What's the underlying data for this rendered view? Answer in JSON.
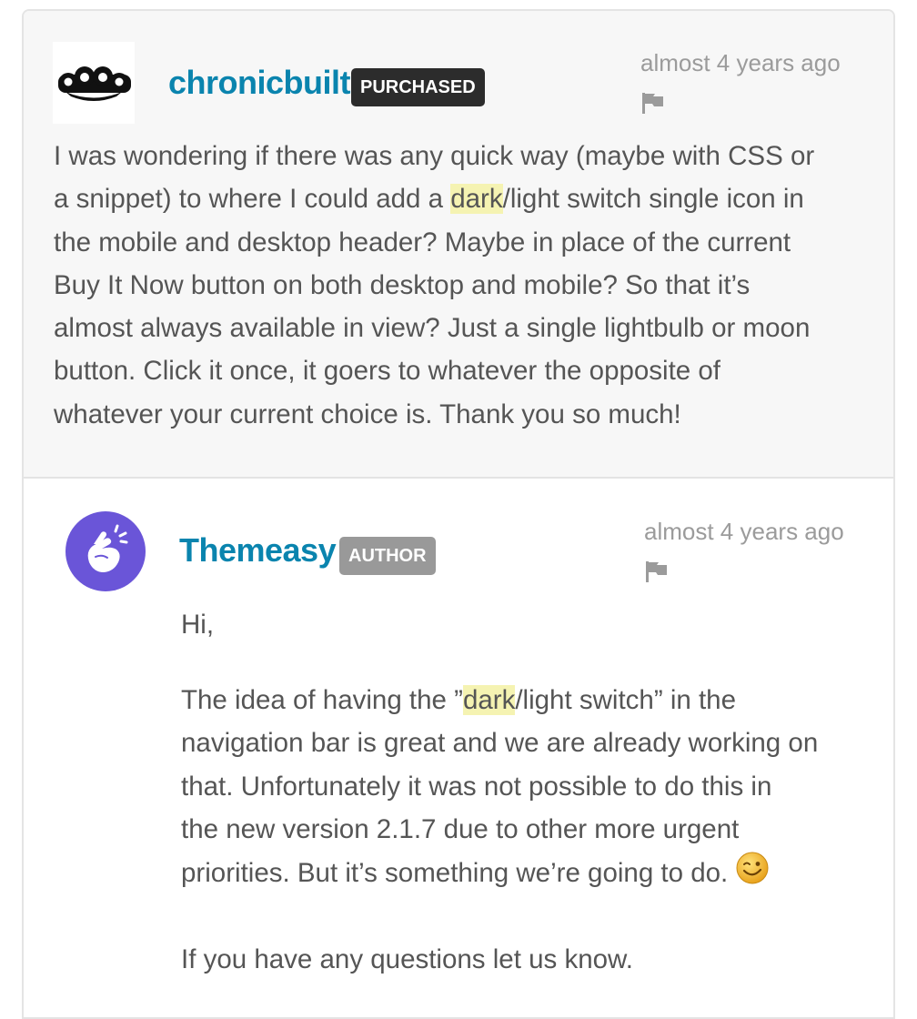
{
  "comments": [
    {
      "username": "chronicbuilt",
      "badge": "PURCHASED",
      "timestamp": "almost 4 years ago",
      "avatar_icon": "brass-knuckles-icon",
      "body_lines": [
        "I was wondering if there was any quick way (maybe with CSS or",
        "a snippet) to where I could add a ",
        "dark",
        "/light switch single icon in",
        "the mobile and desktop header? Maybe in place of the current",
        "Buy It Now button on both desktop and mobile? So that it’s",
        "almost always available in view? Just a single lightbulb or moon",
        "button. Click it once, it goers to whatever the opposite of",
        "whatever your current choice is. Thank you so much!"
      ]
    },
    {
      "username": "Themeasy",
      "badge": "AUTHOR",
      "timestamp": "almost 4 years ago",
      "avatar_icon": "snapping-hand-icon",
      "avatar_color": "#6a55d8",
      "greeting": "Hi,",
      "para2_lines": [
        "The idea of having the ”",
        "dark",
        "/light switch” in the",
        "navigation bar is great and we are already working on",
        "that. Unfortunately it was not possible to do this in",
        "the new version 2.1.7 due to other more urgent",
        "priorities. But it’s something we’re going to do. "
      ],
      "emoji": "winking-smiley-icon",
      "closing": "If you have any questions let us know."
    }
  ],
  "colors": {
    "username": "#0a84ae",
    "highlight": "#f5f3b2",
    "badge_purchased": "#2c2c2c",
    "badge_author": "#999999"
  }
}
